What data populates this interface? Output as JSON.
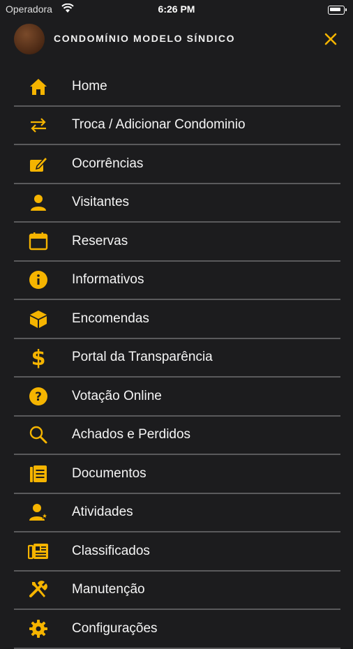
{
  "status_bar": {
    "carrier": "Operadora",
    "time": "6:26 PM"
  },
  "header": {
    "title": "CONDOMÍNIO MODELO SÍNDICO"
  },
  "accent_color": "#f5b400",
  "menu": {
    "items": [
      {
        "label": "Home",
        "icon": "home-icon"
      },
      {
        "label": "Troca / Adicionar Condominio",
        "icon": "swap-arrows-icon"
      },
      {
        "label": "Ocorrências",
        "icon": "edit-note-icon"
      },
      {
        "label": "Visitantes",
        "icon": "person-icon"
      },
      {
        "label": "Reservas",
        "icon": "calendar-icon"
      },
      {
        "label": "Informativos",
        "icon": "info-icon"
      },
      {
        "label": "Encomendas",
        "icon": "package-icon"
      },
      {
        "label": "Portal da Transparência",
        "icon": "dollar-icon"
      },
      {
        "label": "Votação Online",
        "icon": "question-icon"
      },
      {
        "label": "Achados e Perdidos",
        "icon": "search-icon"
      },
      {
        "label": "Documentos",
        "icon": "document-icon"
      },
      {
        "label": "Atividades",
        "icon": "person-star-icon"
      },
      {
        "label": "Classificados",
        "icon": "newspaper-icon"
      },
      {
        "label": "Manutenção",
        "icon": "tools-icon"
      },
      {
        "label": "Configurações",
        "icon": "gear-icon"
      }
    ]
  }
}
